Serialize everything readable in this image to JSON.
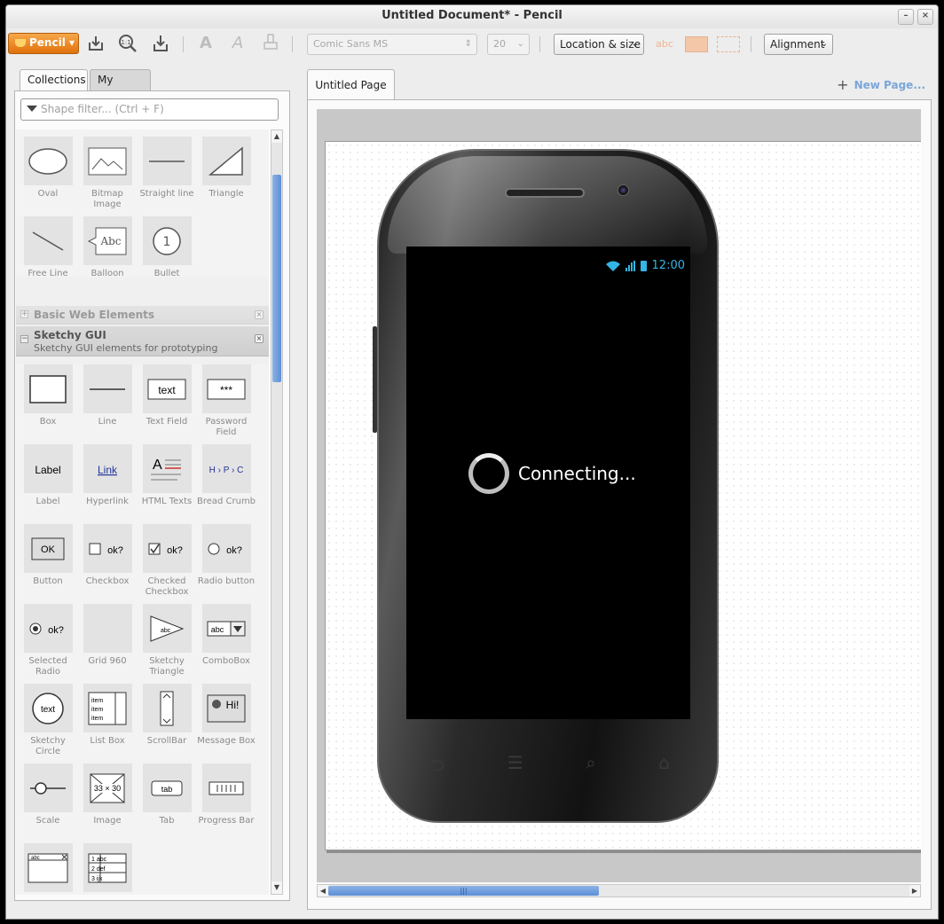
{
  "window": {
    "title": "Untitled Document* - Pencil",
    "minimize_glyph": "–",
    "close_glyph": "×"
  },
  "toolbar": {
    "app_menu_label": "Pencil ▾",
    "font_family": "Comic Sans MS",
    "font_size": "20",
    "location_size_label": "Location & size",
    "alignment_label": "Alignment",
    "text_swatch_label": "abc",
    "icons": [
      "export-icon",
      "zoom-1-1-icon",
      "import-icon",
      "bold-text-icon",
      "italic-text-icon",
      "format-painter-icon"
    ]
  },
  "left_panel": {
    "tabs": [
      "Collections",
      "My Stuffs"
    ],
    "filter_placeholder": "Shape filter... (Ctrl + F)",
    "basic_shapes": [
      {
        "label": "Oval",
        "icon": "oval-icon"
      },
      {
        "label": "Bitmap Image",
        "icon": "bitmap-image-icon"
      },
      {
        "label": "Straight line",
        "icon": "straight-line-icon"
      },
      {
        "label": "Triangle",
        "icon": "triangle-icon"
      },
      {
        "label": "Free Line",
        "icon": "free-line-icon"
      },
      {
        "label": "Balloon",
        "icon": "balloon-icon"
      },
      {
        "label": "Bullet",
        "icon": "bullet-icon"
      }
    ],
    "collapsed_section": {
      "title": "Basic Web Elements"
    },
    "expanded_section": {
      "title": "Sketchy GUI",
      "description": "Sketchy GUI elements for prototyping"
    },
    "sketchy_shapes": [
      {
        "label": "Box"
      },
      {
        "label": "Line"
      },
      {
        "label": "Text Field"
      },
      {
        "label": "Password Field"
      },
      {
        "label": "Label"
      },
      {
        "label": "Hyperlink"
      },
      {
        "label": "HTML Texts"
      },
      {
        "label": "Bread Crumb"
      },
      {
        "label": "Button"
      },
      {
        "label": "Checkbox"
      },
      {
        "label": "Checked Checkbox"
      },
      {
        "label": "Radio button"
      },
      {
        "label": "Selected Radio"
      },
      {
        "label": "Grid 960"
      },
      {
        "label": "Sketchy Triangle"
      },
      {
        "label": "ComboBox"
      },
      {
        "label": "Sketchy Circle"
      },
      {
        "label": "List Box"
      },
      {
        "label": "ScrollBar"
      },
      {
        "label": "Message Box"
      },
      {
        "label": "Scale"
      },
      {
        "label": "Image"
      },
      {
        "label": "Tab"
      },
      {
        "label": "Progress Bar"
      },
      {
        "label": ""
      },
      {
        "label": ""
      }
    ],
    "tile_texts": {
      "text_field": "text",
      "password": "***",
      "label": "Label",
      "link": "Link",
      "breadcrumb": "H › P › C",
      "button": "OK",
      "ok": "ok?",
      "combo": "abc",
      "circle": "text",
      "list_item": "item",
      "message": "Hi!",
      "image": "33 × 30",
      "tab": "tab",
      "window": "abc",
      "balloon": "Abc",
      "bullet": "1",
      "triangle": "abc",
      "html": "A",
      "table_rows": [
        "1 abc",
        "2 def",
        "3 ijk"
      ]
    }
  },
  "editor": {
    "page_tab": "Untitled Page",
    "new_page_label": "New Page...",
    "new_page_glyph": "+",
    "hscroll_grip": "|||"
  },
  "phone": {
    "clock": "12:00",
    "message": "Connecting...",
    "nav_glyphs": [
      "⮌",
      "☰",
      "⌕",
      "⌂"
    ]
  },
  "colors": {
    "accent": "#e0720c",
    "scroll_blue": "#5c8fd6",
    "status_blue": "#33b5e5"
  }
}
